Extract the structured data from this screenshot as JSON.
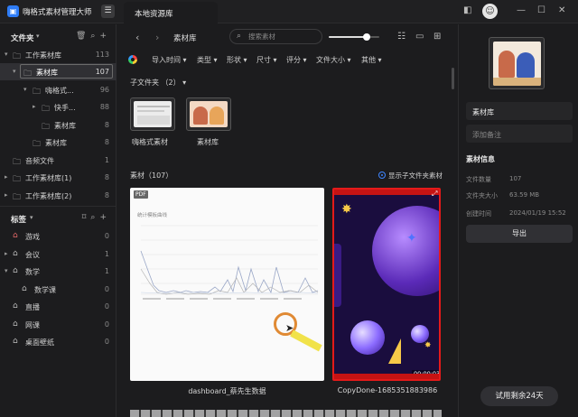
{
  "app": {
    "title": "嗨格式素材管理大师",
    "tab": "本地资源库"
  },
  "sidebar": {
    "folders_title": "文件夹",
    "folders": [
      {
        "label": "工作素材库",
        "count": "113"
      },
      {
        "label": "素材库",
        "count": "107"
      },
      {
        "label": "嗨格式...",
        "count": "96"
      },
      {
        "label": "快手...",
        "count": "88"
      },
      {
        "label": "素材库",
        "count": "8"
      },
      {
        "label": "素材库",
        "count": "8"
      },
      {
        "label": "音频文件",
        "count": "1"
      },
      {
        "label": "工作素材库(1)",
        "count": "8"
      },
      {
        "label": "工作素材库(2)",
        "count": "8"
      }
    ],
    "tags_title": "标签",
    "tags": [
      {
        "label": "游戏",
        "count": "0"
      },
      {
        "label": "会议",
        "count": "1"
      },
      {
        "label": "数学",
        "count": "1"
      },
      {
        "label": "数学课",
        "count": "0"
      },
      {
        "label": "直播",
        "count": "0"
      },
      {
        "label": "网课",
        "count": "0"
      },
      {
        "label": "桌面壁纸",
        "count": "0"
      }
    ]
  },
  "toolbar": {
    "breadcrumb": "素材库",
    "search_placeholder": "搜索素材",
    "thumb_size": 0.75
  },
  "filters": [
    "导入时间",
    "类型",
    "形状",
    "尺寸",
    "评分",
    "文件大小",
    "其他"
  ],
  "subfolders": {
    "header": "子文件夹 （2）",
    "items": [
      {
        "label": "嗨格式素材"
      },
      {
        "label": "素材库"
      }
    ]
  },
  "assets": {
    "header": "素材（107）",
    "show_sub_label": "显示子文件夹素材",
    "items": [
      {
        "name": "dashboard_蔡先生数据",
        "badge": "PDF",
        "preview_title": "统计模板曲线"
      },
      {
        "name": "CopyDone-1685351883986",
        "duration": "00:00:03"
      }
    ]
  },
  "details": {
    "name": "素材库",
    "note_placeholder": "添加备注",
    "info_title": "素材信息",
    "rows": [
      {
        "key": "文件数量",
        "value": "107"
      },
      {
        "key": "文件夹大小",
        "value": "63.59 MB"
      },
      {
        "key": "创建时间",
        "value": "2024/01/19 15:52"
      }
    ],
    "export_label": "导出",
    "trial_label": "试用剩余24天"
  },
  "colors": {
    "accent": "#3f86ff",
    "video_border": "#e41a1a",
    "cursor_ring": "#e08a34"
  },
  "icons": [
    "logo-icon",
    "menu-icon",
    "back-icon",
    "forward-icon",
    "search-icon",
    "view-list-icon",
    "view-grid-icon",
    "trash-icon",
    "add-icon"
  ]
}
